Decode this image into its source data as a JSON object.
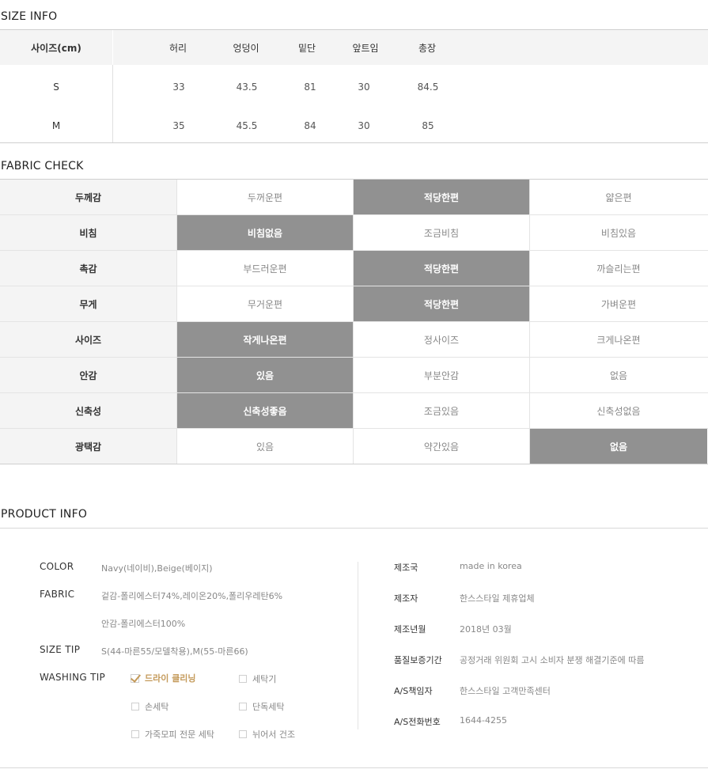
{
  "size_info": {
    "title": "SIZE INFO",
    "header_label": "사이즈(cm)",
    "columns": [
      "허리",
      "엉덩이",
      "밑단",
      "앞트임",
      "총장"
    ],
    "rows": [
      {
        "size": "S",
        "values": [
          "33",
          "43.5",
          "81",
          "30",
          "84.5"
        ]
      },
      {
        "size": "M",
        "values": [
          "35",
          "45.5",
          "84",
          "30",
          "85"
        ]
      }
    ]
  },
  "fabric_check": {
    "title": "FABRIC CHECK",
    "rows": [
      {
        "label": "두께감",
        "options": [
          "두꺼운편",
          "적당한편",
          "얇은편"
        ],
        "selected": 1
      },
      {
        "label": "비침",
        "options": [
          "비침없음",
          "조금비침",
          "비침있음"
        ],
        "selected": 0
      },
      {
        "label": "촉감",
        "options": [
          "부드러운편",
          "적당한편",
          "까슬리는편"
        ],
        "selected": 1
      },
      {
        "label": "무게",
        "options": [
          "무거운편",
          "적당한편",
          "가벼운편"
        ],
        "selected": 1
      },
      {
        "label": "사이즈",
        "options": [
          "작게나온편",
          "정사이즈",
          "크게나온편"
        ],
        "selected": 0
      },
      {
        "label": "안감",
        "options": [
          "있음",
          "부분안감",
          "없음"
        ],
        "selected": 0
      },
      {
        "label": "신축성",
        "options": [
          "신축성좋음",
          "조금있음",
          "신축성없음"
        ],
        "selected": 0
      },
      {
        "label": "광택감",
        "options": [
          "있음",
          "약간있음",
          "없음"
        ],
        "selected": 2
      }
    ]
  },
  "product_info": {
    "title": "PRODUCT INFO",
    "left": {
      "color_label": "COLOR",
      "color_value": "Navy(네이비),Beige(베이지)",
      "fabric_label": "FABRIC",
      "fabric_value_1": "겉감-폴리에스터74%,레이온20%,폴리우레탄6%",
      "fabric_value_2": "안감-폴리에스터100%",
      "size_tip_label": "SIZE TIP",
      "size_tip_value": "S(44-마른55/모델착용),M(55-마른66)",
      "washing_tip_label": "WASHING TIP",
      "washing_options": [
        {
          "label": "드라이 클리닝",
          "checked": true
        },
        {
          "label": "세탁기",
          "checked": false
        },
        {
          "label": "손세탁",
          "checked": false
        },
        {
          "label": "단독세탁",
          "checked": false
        },
        {
          "label": "가죽모피 전문 세탁",
          "checked": false
        },
        {
          "label": "뉘어서 건조",
          "checked": false
        }
      ]
    },
    "right": [
      {
        "label": "제조국",
        "value": "made in korea"
      },
      {
        "label": "제조자",
        "value": "한스스타일 제휴업체"
      },
      {
        "label": "제조년월",
        "value": "2018년 03월"
      },
      {
        "label": "품질보증기간",
        "value": "공정거래 위원회 고시 소비자 분쟁 해결기준에 따름"
      },
      {
        "label": "A/S책임자",
        "value": "한스스타일 고객만족센터"
      },
      {
        "label": "A/S전화번호",
        "value": "1644-4255"
      }
    ]
  },
  "colors": {
    "selected_cell": "#919191",
    "label_bg": "#f4f4f4",
    "check_accent": "#c49a5a"
  }
}
